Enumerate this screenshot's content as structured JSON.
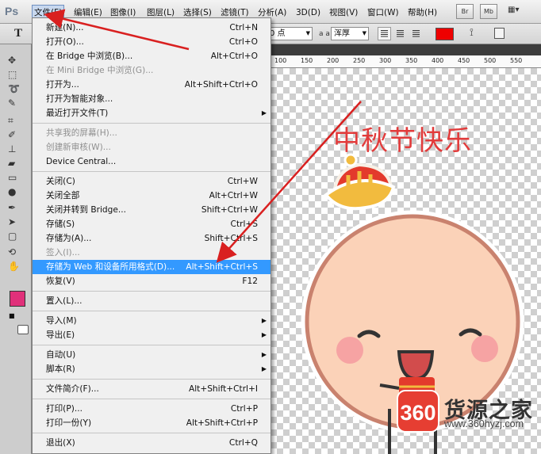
{
  "app": {
    "logo": "Ps"
  },
  "menubar": {
    "items": [
      "文件(F)",
      "编辑(E)",
      "图像(I)",
      "图层(L)",
      "选择(S)",
      "滤镜(T)",
      "分析(A)",
      "3D(D)",
      "视图(V)",
      "窗口(W)",
      "帮助(H)"
    ],
    "bridge_label": "Br",
    "minibridge_label": "Mb"
  },
  "options": {
    "font_size": "0 点",
    "aa_label": "a a",
    "aa_value": "浑厚",
    "text_color": "#ee0000"
  },
  "toolbar": {
    "foreground_color": "#e0307a"
  },
  "canvas": {
    "holiday_text": "中秋节快乐",
    "ruler_marks": [
      "100",
      "150",
      "200",
      "250",
      "300",
      "350",
      "400",
      "450",
      "500",
      "550"
    ]
  },
  "watermark": {
    "logo": "360",
    "text": "货源之家",
    "url": "www.360hyzj.com"
  },
  "file_menu": {
    "groups": [
      [
        {
          "label": "新建(N)...",
          "shortcut": "Ctrl+N",
          "enabled": true
        },
        {
          "label": "打开(O)...",
          "shortcut": "Ctrl+O",
          "enabled": true
        },
        {
          "label": "在 Bridge 中浏览(B)...",
          "shortcut": "Alt+Ctrl+O",
          "enabled": true
        },
        {
          "label": "在 Mini Bridge 中浏览(G)...",
          "shortcut": "",
          "enabled": false
        },
        {
          "label": "打开为...",
          "shortcut": "Alt+Shift+Ctrl+O",
          "enabled": true
        },
        {
          "label": "打开为智能对象...",
          "shortcut": "",
          "enabled": true
        },
        {
          "label": "最近打开文件(T)",
          "shortcut": "",
          "enabled": true,
          "submenu": true
        }
      ],
      [
        {
          "label": "共享我的屏幕(H)...",
          "shortcut": "",
          "enabled": false
        },
        {
          "label": "创建新审核(W)...",
          "shortcut": "",
          "enabled": false
        },
        {
          "label": "Device Central...",
          "shortcut": "",
          "enabled": true
        }
      ],
      [
        {
          "label": "关闭(C)",
          "shortcut": "Ctrl+W",
          "enabled": true
        },
        {
          "label": "关闭全部",
          "shortcut": "Alt+Ctrl+W",
          "enabled": true
        },
        {
          "label": "关闭并转到 Bridge...",
          "shortcut": "Shift+Ctrl+W",
          "enabled": true
        },
        {
          "label": "存储(S)",
          "shortcut": "Ctrl+S",
          "enabled": true
        },
        {
          "label": "存储为(A)...",
          "shortcut": "Shift+Ctrl+S",
          "enabled": true
        },
        {
          "label": "签入(I)...",
          "shortcut": "",
          "enabled": false
        },
        {
          "label": "存储为 Web 和设备所用格式(D)...",
          "shortcut": "Alt+Shift+Ctrl+S",
          "enabled": true,
          "highlighted": true
        },
        {
          "label": "恢复(V)",
          "shortcut": "F12",
          "enabled": true
        }
      ],
      [
        {
          "label": "置入(L)...",
          "shortcut": "",
          "enabled": true
        }
      ],
      [
        {
          "label": "导入(M)",
          "shortcut": "",
          "enabled": true,
          "submenu": true
        },
        {
          "label": "导出(E)",
          "shortcut": "",
          "enabled": true,
          "submenu": true
        }
      ],
      [
        {
          "label": "自动(U)",
          "shortcut": "",
          "enabled": true,
          "submenu": true
        },
        {
          "label": "脚本(R)",
          "shortcut": "",
          "enabled": true,
          "submenu": true
        }
      ],
      [
        {
          "label": "文件简介(F)...",
          "shortcut": "Alt+Shift+Ctrl+I",
          "enabled": true
        }
      ],
      [
        {
          "label": "打印(P)...",
          "shortcut": "Ctrl+P",
          "enabled": true
        },
        {
          "label": "打印一份(Y)",
          "shortcut": "Alt+Shift+Ctrl+P",
          "enabled": true
        }
      ],
      [
        {
          "label": "退出(X)",
          "shortcut": "Ctrl+Q",
          "enabled": true
        }
      ]
    ]
  }
}
